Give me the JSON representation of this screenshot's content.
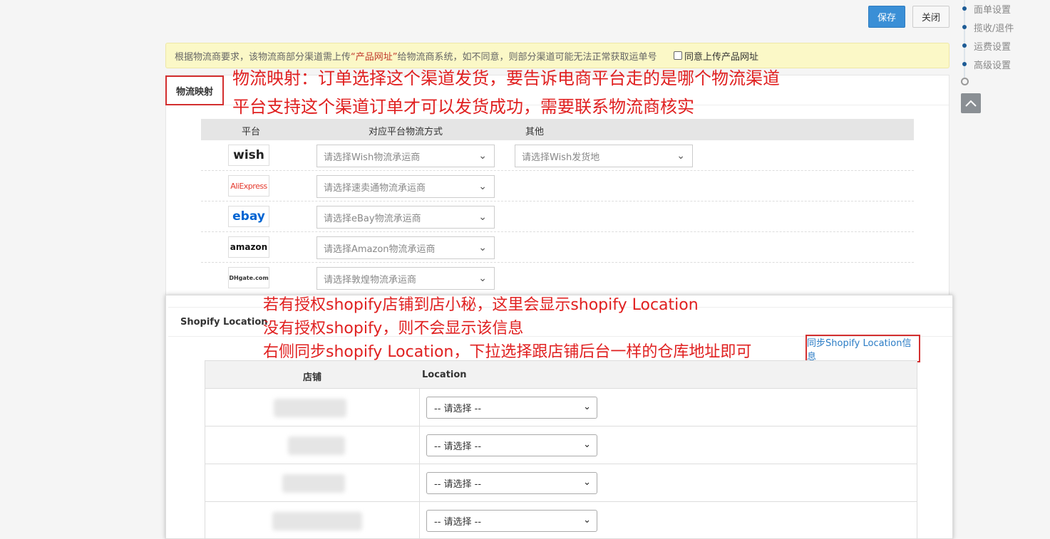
{
  "toolbar": {
    "save_label": "保存",
    "close_label": "关闭"
  },
  "steps": [
    {
      "label": "面单设置"
    },
    {
      "label": "揽收/退件"
    },
    {
      "label": "运费设置"
    },
    {
      "label": "高级设置"
    }
  ],
  "notice": {
    "text_before": "根据物流商要求，该物流商部分渠道需上传",
    "highlight": "“产品网址”",
    "text_after": "给物流商系统，如不同意，则部分渠道可能无法正常获取运单号",
    "agree_label": "同意上传产品网址",
    "agree_checked": false
  },
  "mapping": {
    "title": "物流映射",
    "annotation_line1": "物流映射：订单选择这个渠道发货，要告诉电商平台走的是哪个物流渠道",
    "annotation_line2": "平台支持这个渠道订单才可以发货成功，需要联系物流商核实",
    "columns": [
      "平台",
      "对应平台物流方式",
      "其他"
    ],
    "rows": [
      {
        "platform": "wish",
        "method_placeholder": "请选择Wish物流承运商",
        "other_placeholder": "请选择Wish发货地"
      },
      {
        "platform": "AliExpress",
        "method_placeholder": "请选择速卖通物流承运商"
      },
      {
        "platform": "ebay",
        "method_placeholder": "请选择eBay物流承运商"
      },
      {
        "platform": "amazon",
        "method_placeholder": "请选择Amazon物流承运商"
      },
      {
        "platform": "DHgate.com",
        "method_placeholder": "请选择敦煌物流承运商"
      }
    ]
  },
  "shopify": {
    "title": "Shopify Location",
    "annotation_line1": "若有授权shopify店铺到店小秘，这里会显示shopify Location",
    "annotation_line2": "没有授权shopify，则不会显示该信息",
    "annotation_line3": "右侧同步shopify Location，下拉选择跟店铺后台一样的仓库地址即可",
    "sync_label": "同步Shopify Location信息",
    "columns": [
      "店铺",
      "Location"
    ],
    "rows": [
      {
        "location": "-- 请选择 --"
      },
      {
        "location": "-- 请选择 --"
      },
      {
        "location": "-- 请选择 --"
      },
      {
        "location": "-- 请选择 --"
      }
    ]
  },
  "colors": {
    "accent": "#3a8fd6",
    "annotation": "#e02020",
    "link": "#2b7cc5",
    "notice_bg": "#fbf8c7"
  },
  "icons": [
    "chevron-down-icon",
    "arrow-up-icon",
    "step-dot-icon"
  ]
}
